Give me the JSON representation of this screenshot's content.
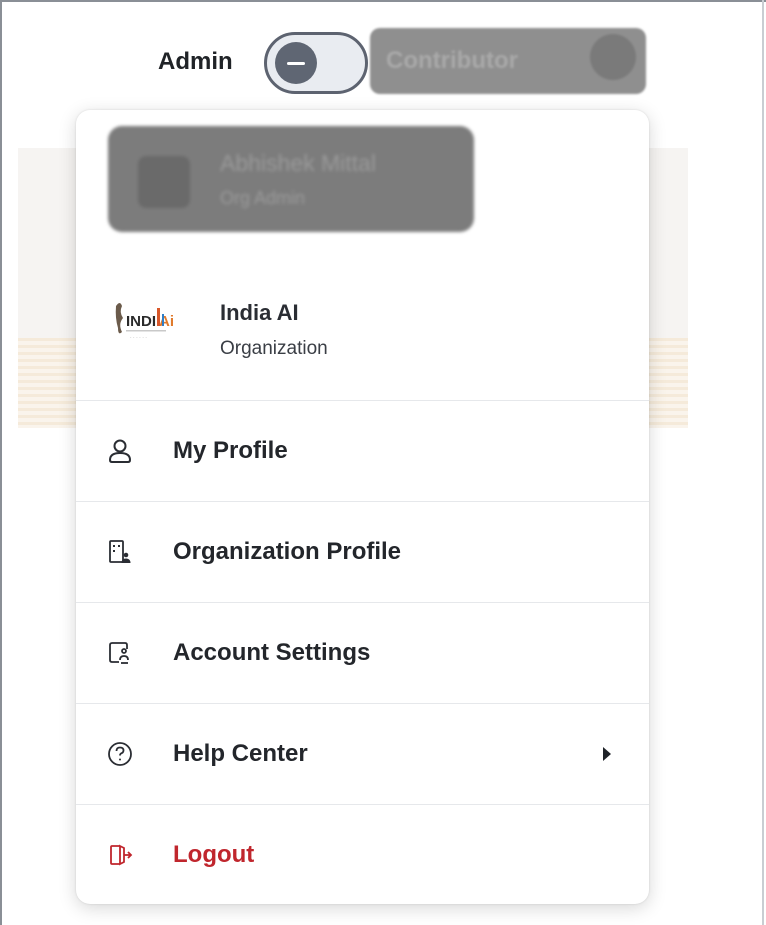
{
  "header": {
    "role_left": "Admin",
    "role_right": "Contributor"
  },
  "user": {
    "name": "Abhishek Mittal",
    "role": "Org Admin"
  },
  "organization": {
    "logo_text": "INDIAai",
    "name": "India AI",
    "type": "Organization"
  },
  "menu": {
    "items": [
      {
        "label": "My Profile",
        "icon": "user-icon"
      },
      {
        "label": "Organization Profile",
        "icon": "building-users-icon"
      },
      {
        "label": "Account Settings",
        "icon": "account-settings-icon"
      },
      {
        "label": "Help Center",
        "icon": "help-circle-icon",
        "submenu": true
      },
      {
        "label": "Logout",
        "icon": "logout-icon"
      }
    ]
  },
  "colors": {
    "logout": "#c0262d",
    "toggle_knob": "#5f6673"
  }
}
